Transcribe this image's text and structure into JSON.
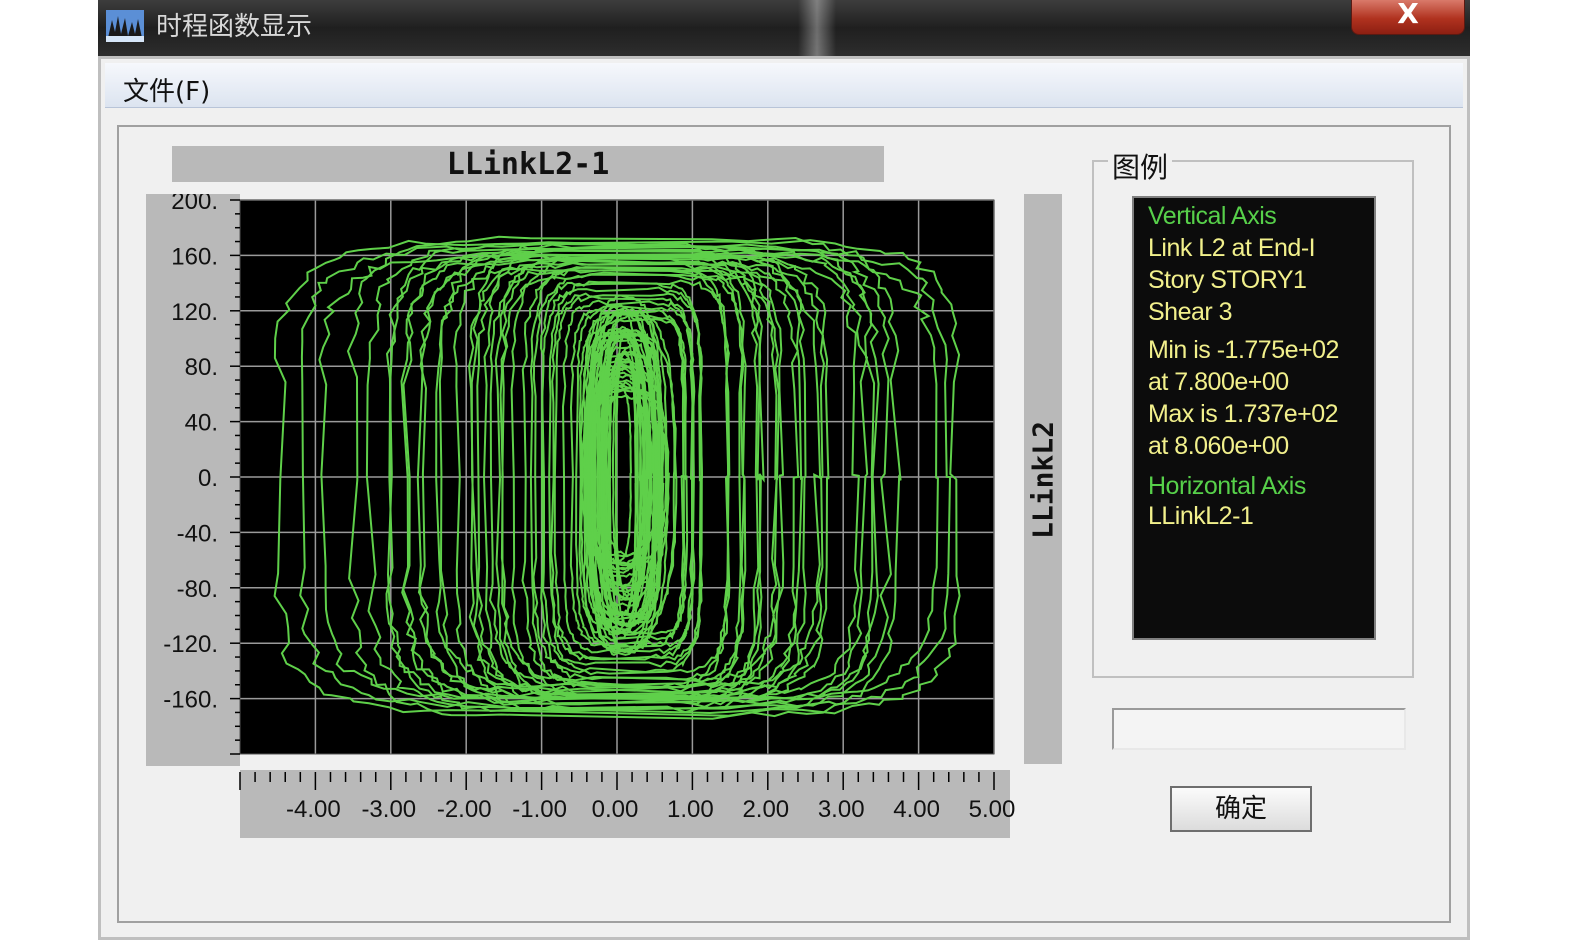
{
  "window": {
    "title": "时程函数显示",
    "close_label": "X"
  },
  "menu": {
    "file_label": "文件(F)"
  },
  "colors": {
    "plot_background": "#000000",
    "curve": "#5fd04a",
    "grid": "#9a9a9a",
    "legend_green": "#57d04a",
    "legend_yellow": "#f2f08c"
  },
  "chart_data": {
    "type": "line",
    "title": "LLinkL2-1",
    "xlabel": "",
    "ylabel": "LLinkL2",
    "xlim": [
      -5.0,
      5.0
    ],
    "ylim": [
      -200,
      200
    ],
    "x_ticks": [
      "-4.00",
      "-3.00",
      "-2.00",
      "-1.00",
      "0.00",
      "1.00",
      "2.00",
      "3.00",
      "4.00",
      "5.00"
    ],
    "y_ticks": [
      "200.",
      "160.",
      "120.",
      "80.",
      "40.",
      "0.",
      "-40.",
      "-80.",
      "-120.",
      "-160."
    ],
    "grid": true,
    "description_hysteresis_loops": [
      {
        "x_half_width": 4.5,
        "y_half_height": 170
      },
      {
        "x_half_width": 3.6,
        "y_half_height": 172
      },
      {
        "x_half_width": 3.2,
        "y_half_height": 168
      },
      {
        "x_half_width": 2.8,
        "y_half_height": 160
      },
      {
        "x_half_width": 2.4,
        "y_half_height": 165
      },
      {
        "x_half_width": 2.0,
        "y_half_height": 155
      },
      {
        "x_half_width": 1.9,
        "y_half_height": 168
      },
      {
        "x_half_width": 1.6,
        "y_half_height": 158
      },
      {
        "x_half_width": 1.3,
        "y_half_height": 150
      },
      {
        "x_half_width": 1.1,
        "y_half_height": 140
      },
      {
        "x_half_width": 0.9,
        "y_half_height": 130
      },
      {
        "x_half_width": 0.7,
        "y_half_height": 120
      },
      {
        "x_half_width": 0.5,
        "y_half_height": 105
      }
    ]
  },
  "legend": {
    "caption": "图例",
    "vertical_axis_header": "Vertical Axis",
    "v_line1": "Link L2 at End-I",
    "v_line2": "Story STORY1",
    "v_line3": "Shear 3",
    "min_line": "Min is -1.775e+02",
    "min_at": "at 7.800e+00",
    "max_line": "Max is 1.737e+02",
    "max_at": "at 8.060e+00",
    "horizontal_axis_header": "Horizontal Axis",
    "h_line1": "LLinkL2-1"
  },
  "status_field": {
    "value": ""
  },
  "buttons": {
    "ok_label": "确定"
  }
}
